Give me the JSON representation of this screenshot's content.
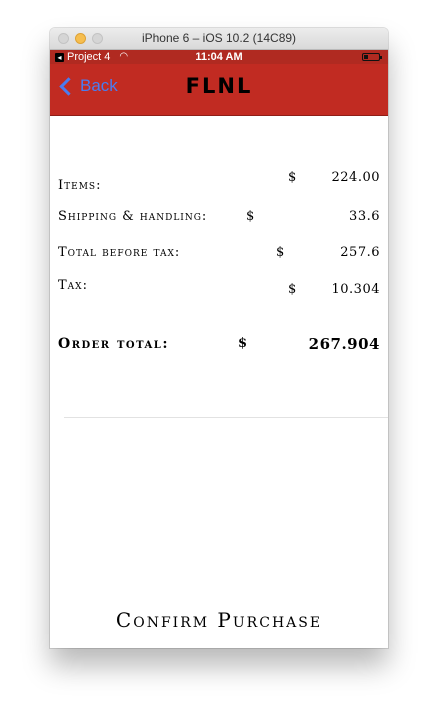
{
  "simulator": {
    "title": "iPhone 6 – iOS 10.2 (14C89)"
  },
  "status_bar": {
    "back_app": "Project 4",
    "time": "11:04 AM"
  },
  "nav": {
    "back_label": "Back",
    "title": "FLNL"
  },
  "summary": {
    "items": {
      "label": "Items:",
      "currency": "$",
      "value": "224.00"
    },
    "shipping": {
      "label": "Shipping & handling:",
      "currency": "$",
      "value": "33.6"
    },
    "before_tax": {
      "label": "Total before tax:",
      "currency": "$",
      "value": "257.6"
    },
    "tax": {
      "label": "Tax:",
      "currency": "$",
      "value": "10.304"
    },
    "order_total": {
      "label": "Order total:",
      "currency": "$",
      "value": "267.904"
    }
  },
  "confirm_label": "Confirm Purchase",
  "colors": {
    "nav_background": "#c12b22",
    "back_link": "#4a7cf0"
  }
}
